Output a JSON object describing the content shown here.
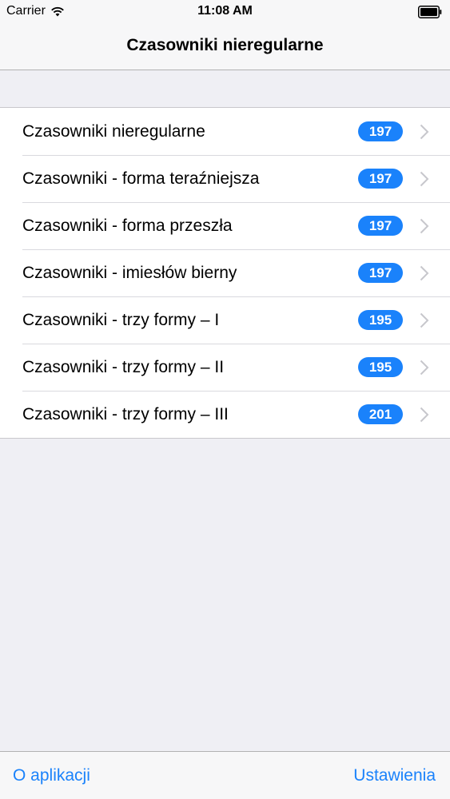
{
  "status_bar": {
    "carrier": "Carrier",
    "time": "11:08 AM",
    "icons": [
      "wifi-icon",
      "battery-icon"
    ]
  },
  "nav": {
    "title": "Czasowniki nieregularne"
  },
  "list": {
    "items": [
      {
        "label": "Czasowniki nieregularne",
        "count": "197"
      },
      {
        "label": "Czasowniki - forma teraźniejsza",
        "count": "197"
      },
      {
        "label": "Czasowniki - forma przeszła",
        "count": "197"
      },
      {
        "label": "Czasowniki - imiesłów bierny",
        "count": "197"
      },
      {
        "label": "Czasowniki - trzy formy – I",
        "count": "195"
      },
      {
        "label": "Czasowniki - trzy formy – II",
        "count": "195"
      },
      {
        "label": "Czasowniki - trzy formy – III",
        "count": "201"
      }
    ],
    "row_icon": "chevron-right-icon"
  },
  "toolbar": {
    "left_label": "O aplikacji",
    "right_label": "Ustawienia"
  },
  "colors": {
    "accent": "#1a82fb",
    "background": "#efeff4",
    "bar": "#f7f7f8"
  }
}
